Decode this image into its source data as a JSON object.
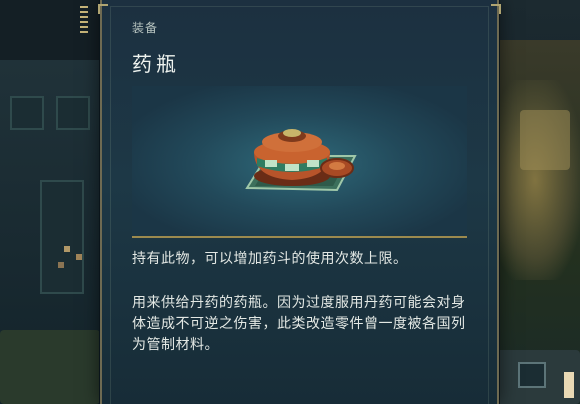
{
  "item": {
    "category": "装备",
    "name": "药瓶",
    "effect": "持有此物，可以增加药斗的使用次数上限。",
    "lore": "用来供给丹药的药瓶。因为过度服用丹药可能会对身体造成不可逆之伤害，此类改造零件曾一度被各国列为管制材料。",
    "icon": "medicine-jar-icon"
  },
  "colors": {
    "panel": "#1d3846",
    "accent_gold": "#9c8a4e",
    "text": "#e3e8e4"
  }
}
